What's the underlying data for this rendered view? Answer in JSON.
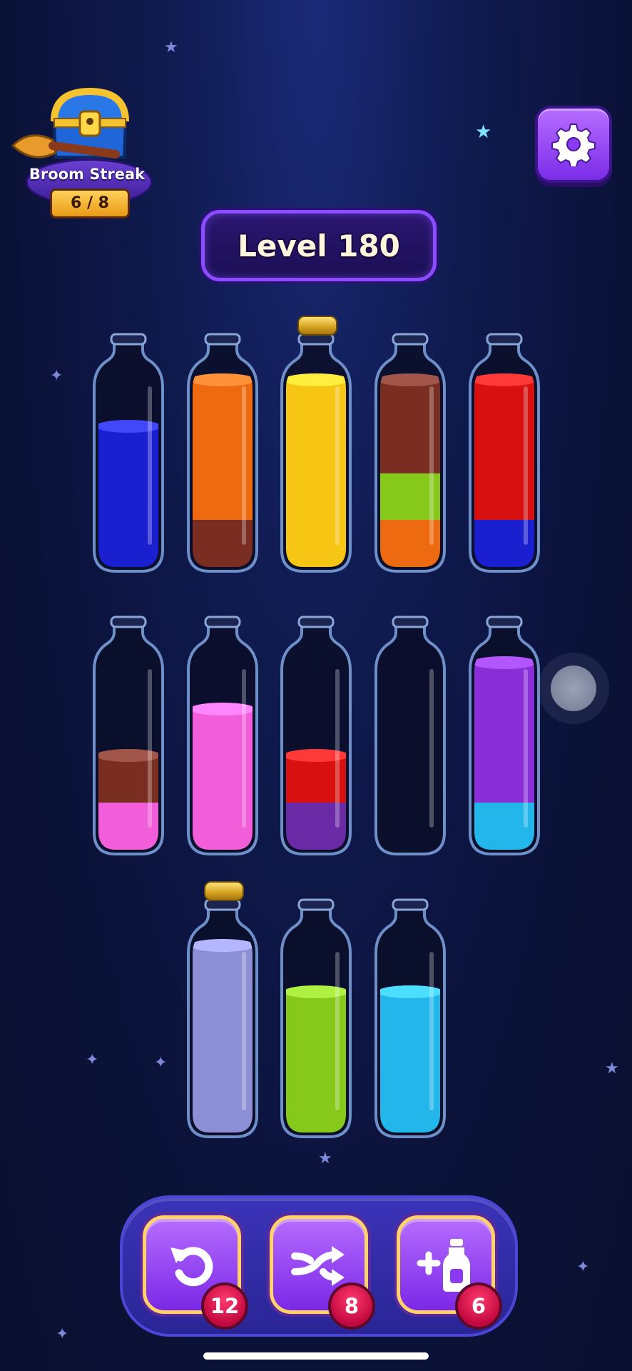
{
  "streak": {
    "label": "Broom Streak",
    "count": "6 / 8"
  },
  "level": {
    "label": "Level 180"
  },
  "colors": {
    "blue": "#1a1fd0",
    "orange": "#ee6a10",
    "brown": "#7a2e22",
    "yellow": "#f7c615",
    "green": "#86c91a",
    "red": "#d91010",
    "pink": "#f25ed9",
    "purple": "#6a2aa5",
    "violet": "#8a2fd8",
    "cyan": "#23b6ea",
    "lavender": "#8c8ed6"
  },
  "bottles": [
    {
      "id": "b1",
      "layers": [
        "blue",
        "blue",
        "blue"
      ],
      "corked": false
    },
    {
      "id": "b2",
      "layers": [
        "brown",
        "orange",
        "orange",
        "orange"
      ],
      "corked": false
    },
    {
      "id": "b3",
      "layers": [
        "yellow",
        "yellow",
        "yellow",
        "yellow"
      ],
      "corked": true
    },
    {
      "id": "b4",
      "layers": [
        "orange",
        "green",
        "brown",
        "brown"
      ],
      "corked": false
    },
    {
      "id": "b5",
      "layers": [
        "blue",
        "red",
        "red",
        "red"
      ],
      "corked": false
    },
    {
      "id": "b6",
      "layers": [
        "pink",
        "brown"
      ],
      "corked": false
    },
    {
      "id": "b7",
      "layers": [
        "pink",
        "pink",
        "pink"
      ],
      "corked": false
    },
    {
      "id": "b8",
      "layers": [
        "purple",
        "red"
      ],
      "corked": false
    },
    {
      "id": "b9",
      "layers": [],
      "corked": false
    },
    {
      "id": "b10",
      "layers": [
        "cyan",
        "violet",
        "violet",
        "violet"
      ],
      "corked": false
    },
    {
      "id": "b11",
      "layers": [
        "lavender",
        "lavender",
        "lavender",
        "lavender"
      ],
      "corked": true
    },
    {
      "id": "b12",
      "layers": [
        "green",
        "green",
        "green"
      ],
      "corked": false
    },
    {
      "id": "b13",
      "layers": [
        "cyan",
        "cyan",
        "cyan"
      ],
      "corked": false
    }
  ],
  "tools": {
    "undo": {
      "icon": "undo-icon",
      "count": "12"
    },
    "shuffle": {
      "icon": "shuffle-icon",
      "count": "8"
    },
    "add_bottle": {
      "icon": "add-bottle-icon",
      "count": "6"
    }
  }
}
